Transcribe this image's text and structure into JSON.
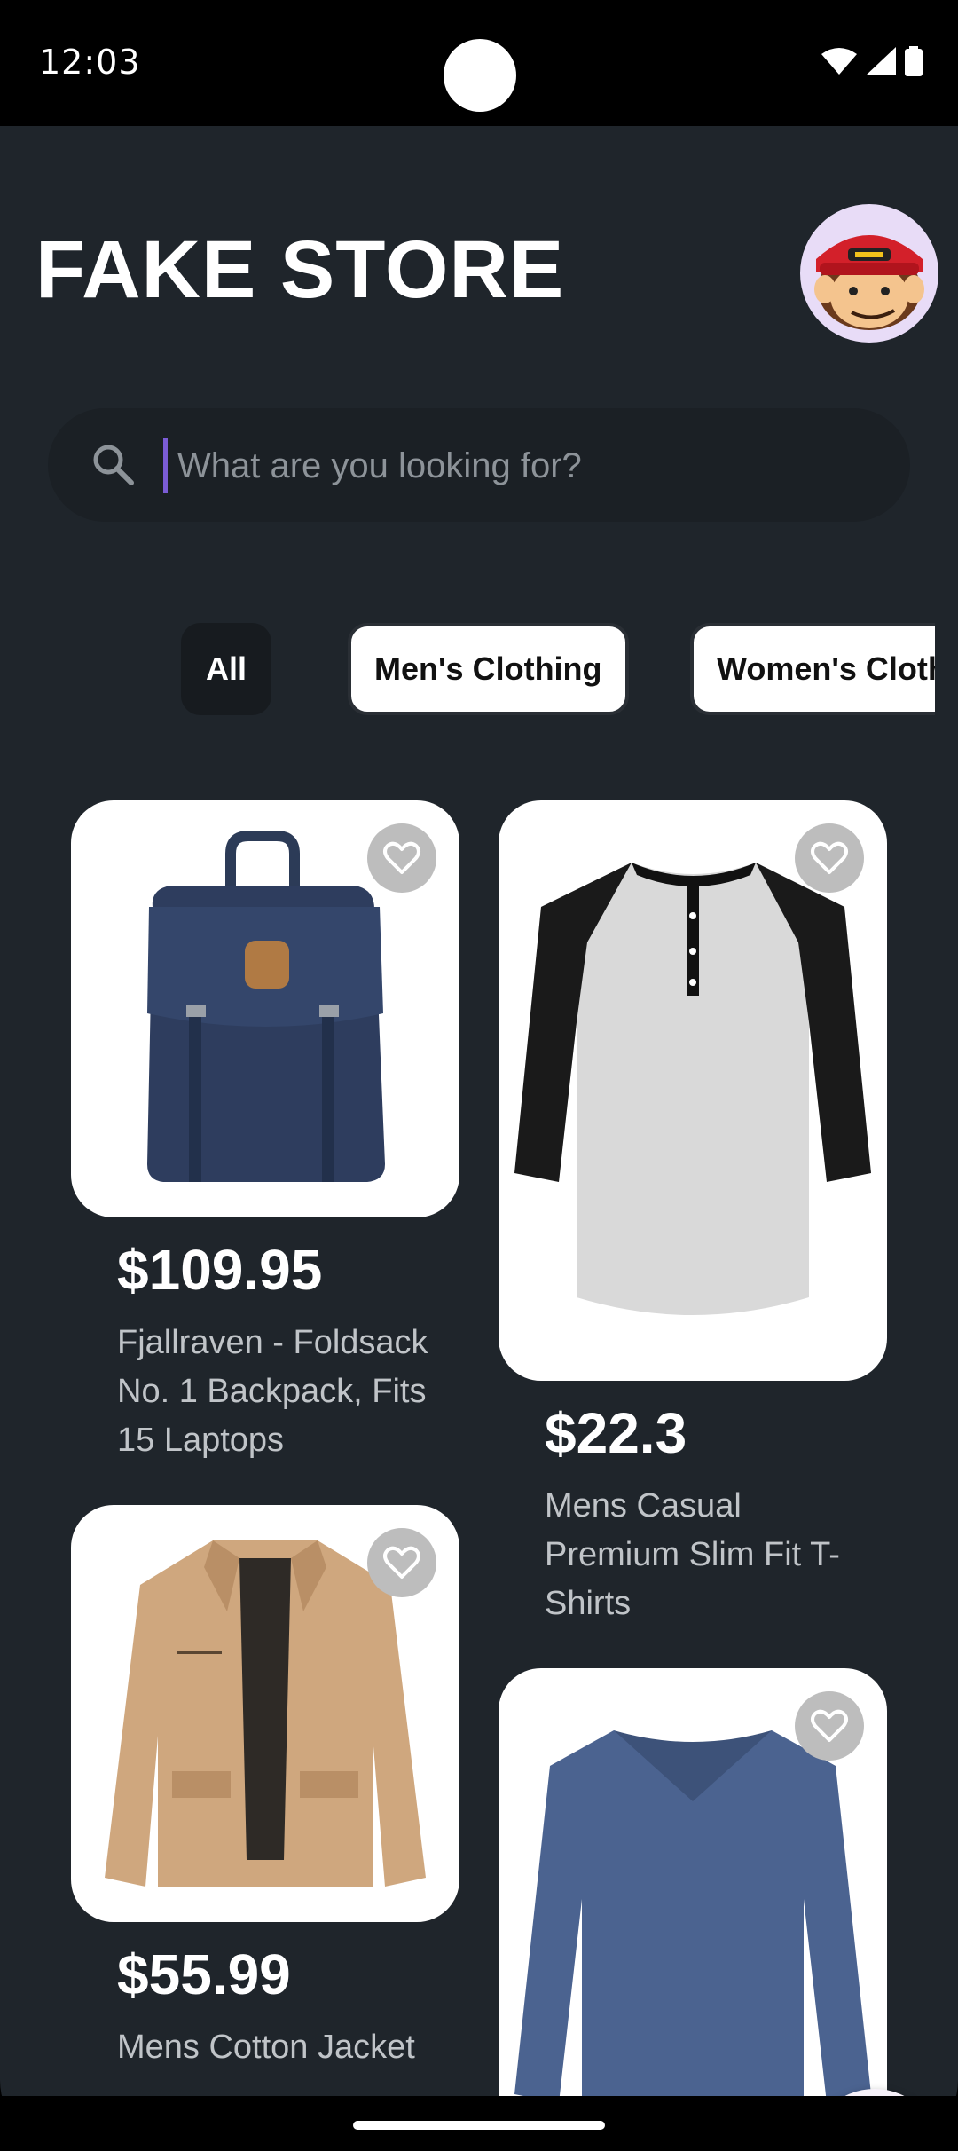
{
  "status_bar": {
    "time": "12:03"
  },
  "header": {
    "title": "FAKE STORE",
    "avatar": "avatar-monkey-cap"
  },
  "search": {
    "placeholder": "What are you looking for?",
    "icon": "search-icon"
  },
  "categories": [
    "All",
    "Men's Clothing",
    "Women's Cloth"
  ],
  "selected_category": "All",
  "products": [
    {
      "price": "$109.95",
      "name": "Fjallraven - Foldsack No. 1 Backpack, Fits 15 Laptops",
      "image": "navy-backpack",
      "favorite": false
    },
    {
      "price": "$22.3",
      "name": "Mens Casual Premium Slim Fit T-Shirts",
      "image": "raglan-henley-tshirt",
      "favorite": false
    },
    {
      "price": "$55.99",
      "name": "Mens Cotton Jacket",
      "image": "khaki-jacket",
      "favorite": false
    },
    {
      "price": "",
      "name": "",
      "image": "blue-vneck-longsleeve",
      "favorite": false
    }
  ],
  "fab": {
    "icon": "menu-icon"
  },
  "colors": {
    "background": "#1f252b",
    "card": "#ffffff",
    "accent": "#7b5cd6",
    "fab": "#f7f2fa"
  }
}
